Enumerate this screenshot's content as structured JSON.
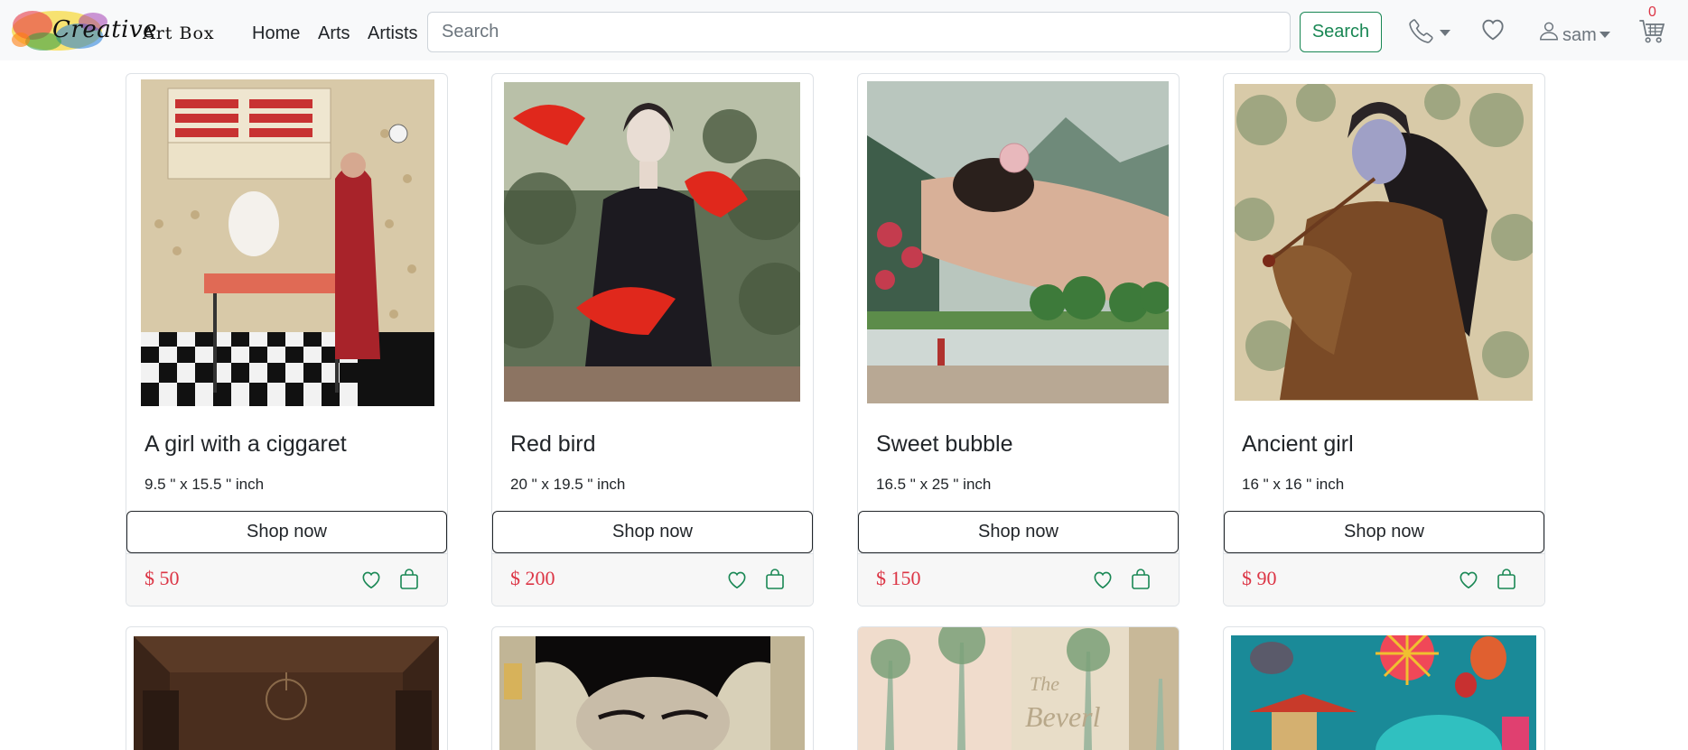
{
  "brand": {
    "logo_text": "Creative",
    "logo_text2": "Art Box"
  },
  "nav": {
    "links": [
      "Home",
      "Arts",
      "Artists"
    ],
    "search_placeholder": "Search",
    "search_button": "Search",
    "user_name": "sam",
    "cart_count": "0"
  },
  "colors": {
    "accent_green": "#198754",
    "price_red": "#dc3545",
    "icon_gray": "#6c757d"
  },
  "products": [
    {
      "title": "A girl with a ciggaret",
      "size": "9.5 \" x 15.5 \" inch",
      "button": "Shop now",
      "price": "$ 50"
    },
    {
      "title": "Red bird",
      "size": "20 \" x 19.5 \" inch",
      "button": "Shop now",
      "price": "$ 200"
    },
    {
      "title": "Sweet bubble",
      "size": "16.5 \" x 25 \" inch",
      "button": "Shop now",
      "price": "$ 150"
    },
    {
      "title": "Ancient girl",
      "size": "16 \" x 16 \" inch",
      "button": "Shop now",
      "price": "$ 90"
    }
  ]
}
